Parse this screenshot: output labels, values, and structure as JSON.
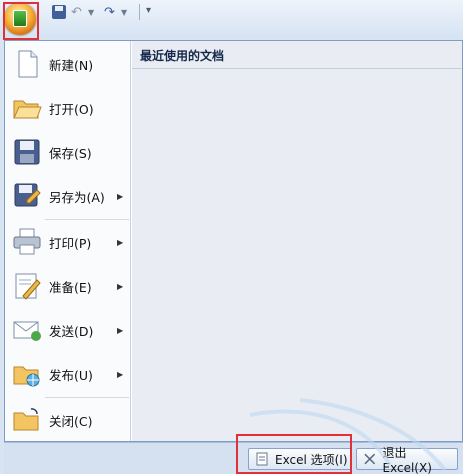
{
  "quick_access": {
    "office_button": "office-button",
    "save": "save-icon",
    "undo": "undo-icon",
    "redo": "redo-icon",
    "customize": "customize-qat-icon",
    "undo_glyph": "↶",
    "redo_glyph": "↷",
    "drop_glyph": "▼",
    "custom_glyph": "▾"
  },
  "menu": {
    "items": [
      {
        "label": "新建(N)",
        "icon": "new-document-icon",
        "submenu": false
      },
      {
        "label": "打开(O)",
        "icon": "open-folder-icon",
        "submenu": false
      },
      {
        "label": "保存(S)",
        "icon": "save-disk-icon",
        "submenu": false
      },
      {
        "label": "另存为(A)",
        "icon": "save-as-icon",
        "submenu": true
      },
      {
        "label": "打印(P)",
        "icon": "printer-icon",
        "submenu": true
      },
      {
        "label": "准备(E)",
        "icon": "prepare-icon",
        "submenu": true
      },
      {
        "label": "发送(D)",
        "icon": "send-icon",
        "submenu": true
      },
      {
        "label": "发布(U)",
        "icon": "publish-icon",
        "submenu": true
      },
      {
        "label": "关闭(C)",
        "icon": "close-folder-icon",
        "submenu": false
      }
    ],
    "arrow_glyph": "▶"
  },
  "recent": {
    "title": "最近使用的文档"
  },
  "bottom": {
    "options_label": "Excel 选项(I)",
    "exit_label": "退出 Excel(X)"
  },
  "colors": {
    "highlight_frame": "#e0303a",
    "panel_border": "#7f9cc5"
  }
}
